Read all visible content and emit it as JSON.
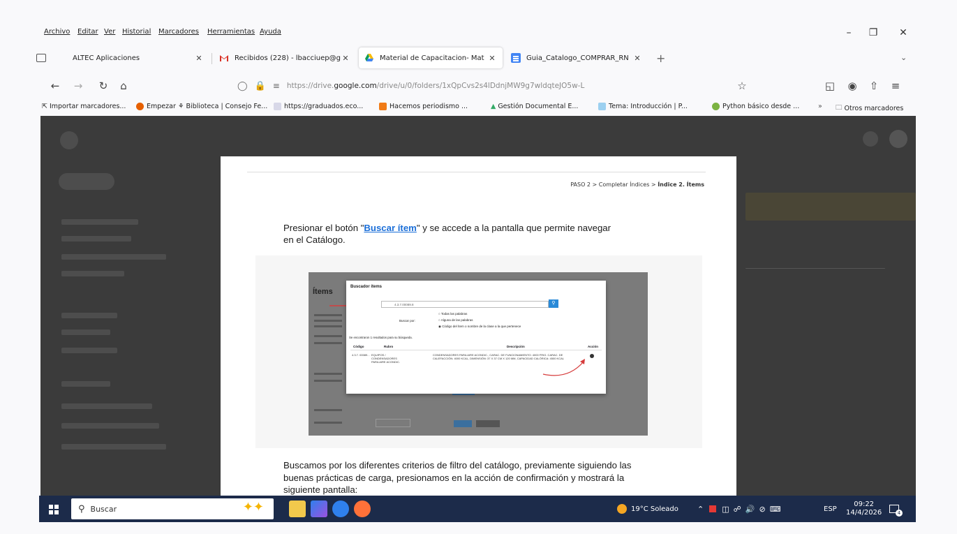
{
  "menu": [
    "Archivo",
    "Editar",
    "Ver",
    "Historial",
    "Marcadores",
    "Herramientas",
    "Ayuda"
  ],
  "tabs": [
    {
      "label": "ALTEC Aplicaciones",
      "icon": "window-icon"
    },
    {
      "label": "Recibidos (228) - lbacciuep@g",
      "icon": "gmail-icon"
    },
    {
      "label": "Material de Capacitacion- Mat",
      "icon": "drive-icon"
    },
    {
      "label": "Guia_Catalogo_COMPRAR_RN",
      "icon": "docs-icon"
    }
  ],
  "url": {
    "prefix": "https://drive.",
    "domain": "google.com",
    "path": "/drive/u/0/folders/1xQpCvs2s4lDdnjMW9g7wldqteJO5w-L"
  },
  "bookmarks": [
    "Importar marcadores...",
    "Empezar",
    "Biblioteca | Consejo Fe...",
    "https://graduados.eco...",
    "Hacemos periodismo ...",
    "Gestión Documental E...",
    "Tema: Introducción | P...",
    "Python básico desde ...",
    "Otros marcadores"
  ],
  "doc": {
    "breadcrumb_pre": "PASO 2 > Completar Índices > ",
    "breadcrumb_bold": "Índice 2. Ítems",
    "p1_pre": "Presionar el botón \"",
    "p1_link": "Buscar ítem",
    "p1_post": "\" y se accede a la pantalla que permite navegar",
    "p1_line2": "en el Catálogo.",
    "p2_line1": "Buscamos por los diferentes criterios de filtro del catálogo, previamente siguiendo las",
    "p2_line2": "buenas prácticas de carga, presionamos en la acción de confirmación y mostrará la",
    "p2_line3": "siguiente pantalla:"
  },
  "embed": {
    "bg_title": "Ítems",
    "modal_title": "Buscador ítems",
    "search_value": "4.3.7.00089.8",
    "buscar_por": "Buscar por:",
    "options": [
      "Todas las palabras",
      "Alguna de las palabras",
      "Código del ítem o nombre de la clase a la que pertenece"
    ],
    "results_note": "Se encontraron 1 resultados para su búsqueda.",
    "columns": [
      "Código",
      "Rubro",
      "Descripción",
      "Acción"
    ],
    "row": {
      "code": "4.3.7. 00089...",
      "rubro": "EQUIPOS / CONDENSADORES PARA AIRE ACONDIC.",
      "desc": "CONDENSADORES PARA AIRE ACONDIC., CARAC. DE FUNCIONAMIENTO: 4000 FRIG. CARAC. DE CALEFACCIÓN: 4000 KCAL, DIMENSIÓN: 37 X 37 CM X 120 MM, CAPACIDAD CALÓRICA: 4500 KCAL"
    }
  },
  "taskbar": {
    "search_placeholder": "Buscar",
    "weather": "19°C Soleado",
    "lang": "ESP",
    "time": "09:22",
    "date": "14/4/2026",
    "notif_count": "4"
  }
}
